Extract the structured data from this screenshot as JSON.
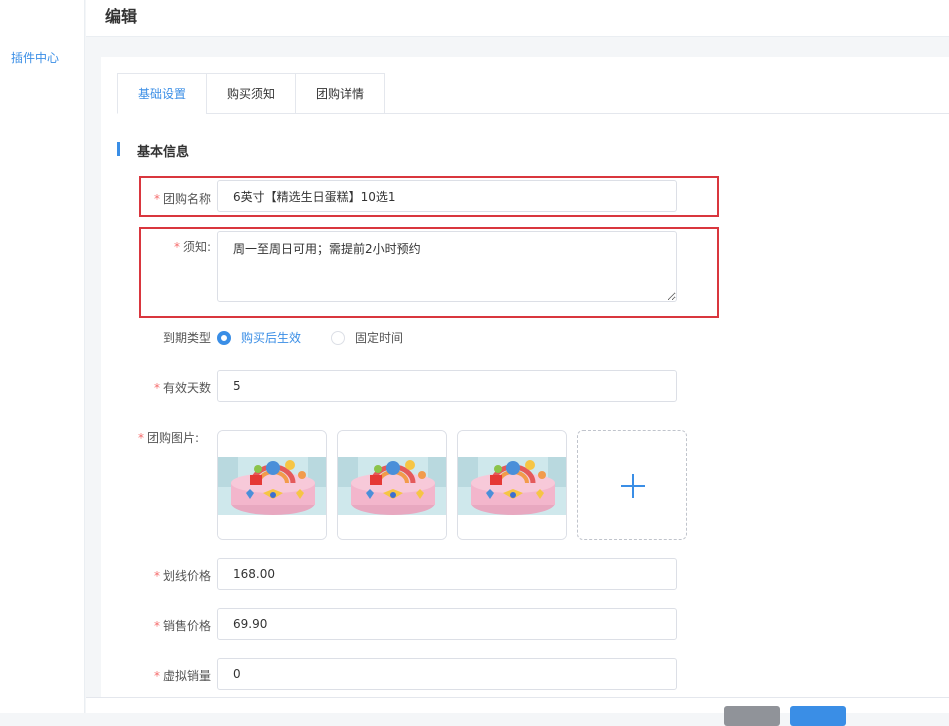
{
  "sidebar": {
    "items": [
      {
        "label": "插件中心"
      }
    ]
  },
  "header": {
    "title": "编辑"
  },
  "tabs": [
    {
      "label": "基础设置",
      "active": true
    },
    {
      "label": "购买须知",
      "active": false
    },
    {
      "label": "团购详情",
      "active": false
    }
  ],
  "section": {
    "title": "基本信息"
  },
  "form": {
    "name": {
      "label": "团购名称",
      "value": "6英寸【精选生日蛋糕】10选1"
    },
    "notice": {
      "label": "须知:",
      "value": "周一至周日可用；需提前2小时预约"
    },
    "expire": {
      "label": "到期类型",
      "options": [
        "购买后生效",
        "固定时间"
      ],
      "selected": "购买后生效"
    },
    "valid_days": {
      "label": "有效天数",
      "value": "5"
    },
    "images": {
      "label": "团购图片:",
      "count": 3
    },
    "original_price": {
      "label": "划线价格",
      "value": "168.00"
    },
    "sale_price": {
      "label": "销售价格",
      "value": "69.90"
    },
    "virtual_sales": {
      "label": "虚拟销量",
      "value": "0"
    }
  },
  "colors": {
    "accent": "#3a8ee6",
    "required": "#f56c6c",
    "highlight": "#d9363e"
  }
}
